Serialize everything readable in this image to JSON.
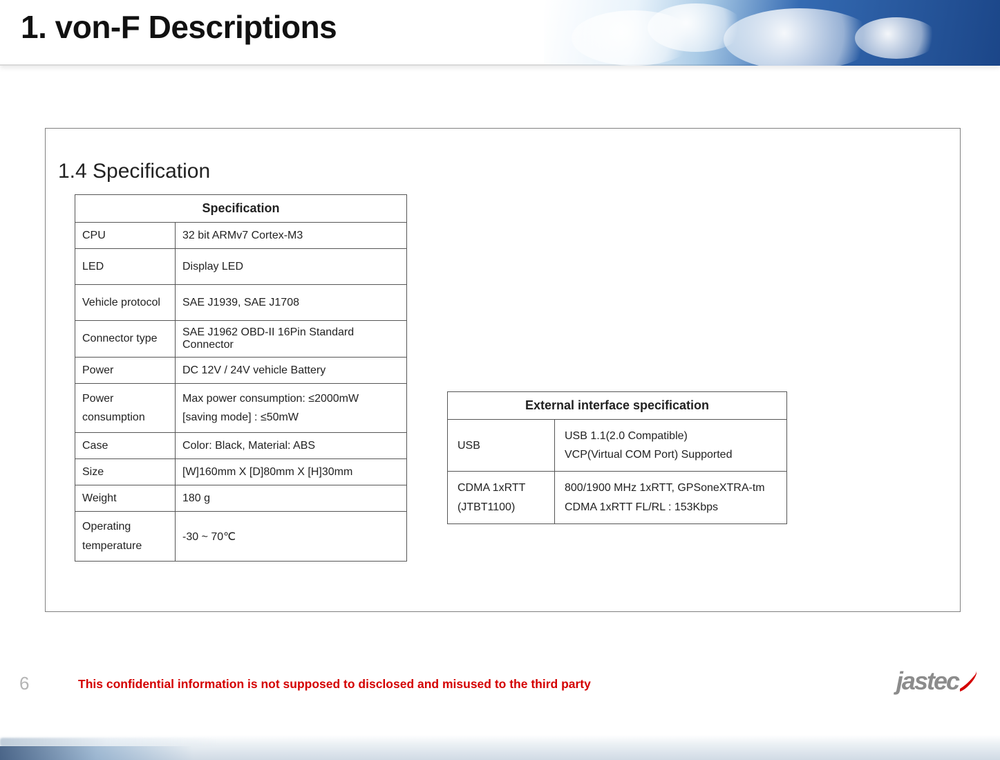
{
  "header": {
    "title": "1. von-F Descriptions"
  },
  "section": {
    "title": "1.4 Specification"
  },
  "spec_table": {
    "header": "Specification",
    "rows": [
      {
        "label": "CPU",
        "value": "32 bit ARMv7 Cortex-M3"
      },
      {
        "label": "LED",
        "value": "Display LED"
      },
      {
        "label": "Vehicle protocol",
        "value": "SAE J1939, SAE J1708"
      },
      {
        "label": "Connector type",
        "value": "SAE J1962 OBD-II 16Pin Standard Connector"
      },
      {
        "label": "Power",
        "value": "DC 12V / 24V  vehicle Battery"
      },
      {
        "label": "Power consumption",
        "value_line1": "Max power consumption: ≤2000mW",
        "value_line2": "[saving mode] : ≤50mW"
      },
      {
        "label": "Case",
        "value": "Color: Black, Material: ABS"
      },
      {
        "label": "Size",
        "value": "[W]160mm X [D]80mm X [H]30mm"
      },
      {
        "label": "Weight",
        "value": "180 g"
      },
      {
        "label": "Operating temperature",
        "value": "-30 ~ 70℃"
      }
    ]
  },
  "ext_table": {
    "header": "External interface specification",
    "rows": [
      {
        "label": "USB",
        "value_line1": "USB 1.1(2.0 Compatible)",
        "value_line2": "VCP(Virtual COM Port) Supported"
      },
      {
        "label_line1": "CDMA 1xRTT",
        "label_line2": "(JTBT1100)",
        "value_line1": "800/1900 MHz 1xRTT, GPSoneXTRA-tm",
        "value_line2": "CDMA 1xRTT FL/RL : 153Kbps"
      }
    ]
  },
  "footer": {
    "page_number": "6",
    "confidential": "This confidential information is not supposed to disclosed and misused to the third party",
    "logo_text": "jastec"
  }
}
